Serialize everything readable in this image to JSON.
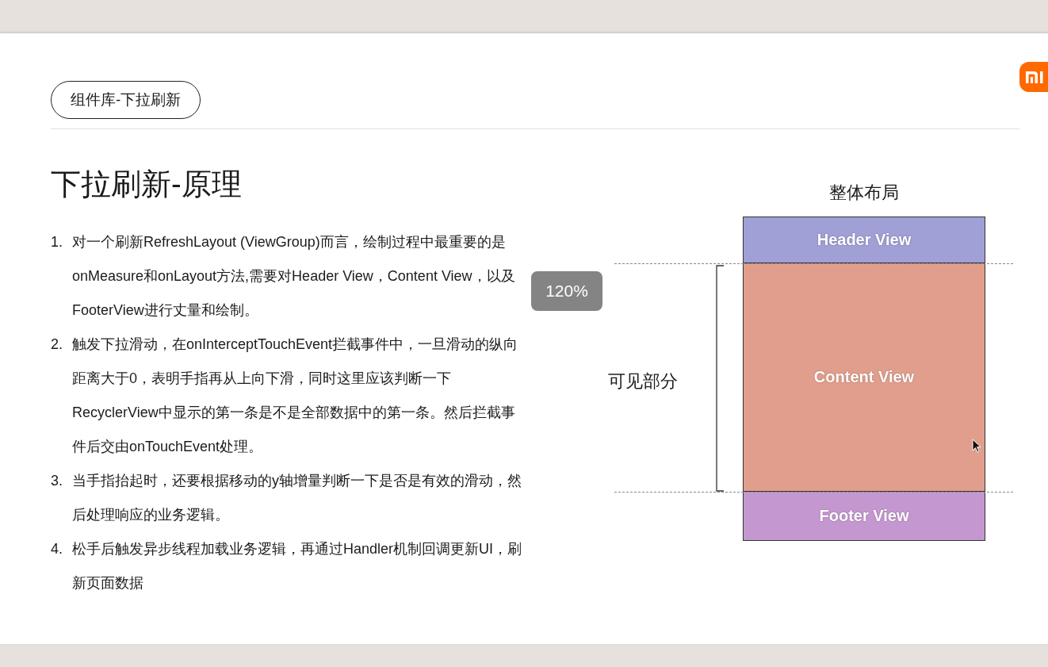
{
  "slide": {
    "section_tag": "组件库-下拉刷新",
    "heading": "下拉刷新-原理",
    "points": [
      {
        "number": "1.",
        "text": "对一个刷新RefreshLayout (ViewGroup)而言，绘制过程中最重要的是onMeasure和onLayout方法,需要对Header View，Content View，以及FooterView进行丈量和绘制。"
      },
      {
        "number": "2.",
        "text": "触发下拉滑动，在onInterceptTouchEvent拦截事件中，一旦滑动的纵向距离大于0，表明手指再从上向下滑，同时这里应该判断一下RecyclerView中显示的第一条是不是全部数据中的第一条。然后拦截事件后交由onTouchEvent处理。"
      },
      {
        "number": "3.",
        "text": "当手指抬起时，还要根据移动的y轴增量判断一下是否是有效的滑动，然后处理响应的业务逻辑。"
      },
      {
        "number": "4.",
        "text": "松手后触发异步线程加载业务逻辑，再通过Handler机制回调更新UI，刷新页面数据"
      }
    ]
  },
  "diagram": {
    "title": "整体布局",
    "side_label": "可见部分",
    "blocks": [
      {
        "kind": "header",
        "label": "Header View",
        "color": "#a09fd6"
      },
      {
        "kind": "content",
        "label": "Content View",
        "color": "#e29e8c"
      },
      {
        "kind": "footer",
        "label": "Footer View",
        "color": "#c597d0"
      }
    ]
  },
  "zoom_indicator": "120%"
}
